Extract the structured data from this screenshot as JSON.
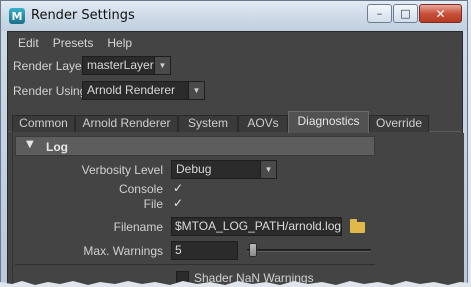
{
  "window": {
    "title": "Render Settings",
    "app_icon_glyph": "M",
    "controls": {
      "minimize": "–",
      "maximize": "□",
      "close": "✕"
    }
  },
  "menubar": {
    "items": [
      "Edit",
      "Presets",
      "Help"
    ]
  },
  "render_layer": {
    "label": "Render Layer",
    "value": "masterLayer"
  },
  "render_using": {
    "label": "Render Using",
    "value": "Arnold Renderer"
  },
  "tabs": [
    {
      "label": "Common",
      "active": false
    },
    {
      "label": "Arnold Renderer",
      "active": false
    },
    {
      "label": "System",
      "active": false
    },
    {
      "label": "AOVs",
      "active": false
    },
    {
      "label": "Diagnostics",
      "active": true
    },
    {
      "label": "Override",
      "active": false
    }
  ],
  "log_section": {
    "title": "Log",
    "expand_glyph": "▼",
    "verbosity": {
      "label": "Verbosity Level",
      "value": "Debug"
    },
    "console": {
      "label": "Console",
      "checked": true
    },
    "file": {
      "label": "File",
      "checked": true
    },
    "filename": {
      "label": "Filename",
      "value": "$MTOA_LOG_PATH/arnold.log"
    },
    "max_warnings": {
      "label": "Max. Warnings",
      "value": "5"
    },
    "shader_nan": {
      "label": "Shader NaN Warnings",
      "checked": false
    }
  },
  "glyphs": {
    "check": "✓",
    "dropdown_arrow": "▼"
  },
  "colors": {
    "panel_bg": "#444444",
    "field_bg": "#2b2b2b",
    "folder": "#e1b84a",
    "close_button": "#c8523c"
  }
}
